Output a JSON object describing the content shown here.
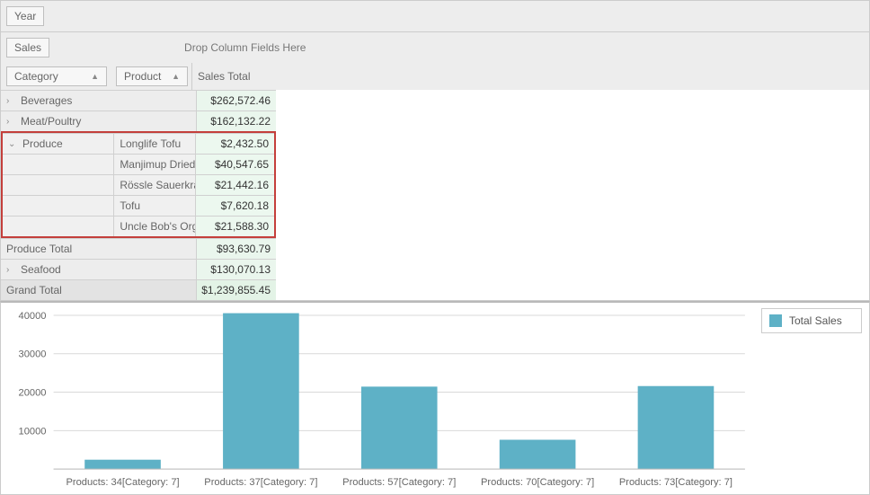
{
  "pivot": {
    "filter_field": "Year",
    "data_field": "Sales",
    "drop_hint": "Drop Column Fields Here",
    "row_fields": [
      {
        "label": "Category",
        "sort": "asc"
      },
      {
        "label": "Product",
        "sort": "asc"
      }
    ],
    "value_header": "Sales Total",
    "rows": [
      {
        "kind": "cat_collapsed",
        "label": "Beverages",
        "value": "$262,572.46"
      },
      {
        "kind": "cat_collapsed",
        "label": "Meat/Poultry",
        "value": "$162,132.22"
      }
    ],
    "produce": {
      "label": "Produce",
      "items": [
        {
          "label": "Longlife Tofu",
          "value": "$2,432.50"
        },
        {
          "label": "Manjimup Dried A...",
          "value": "$40,547.65"
        },
        {
          "label": "Rössle Sauerkraut",
          "value": "$21,442.16"
        },
        {
          "label": "Tofu",
          "value": "$7,620.18"
        },
        {
          "label": "Uncle Bob's Orga...",
          "value": "$21,588.30"
        }
      ]
    },
    "produce_total": {
      "label": "Produce Total",
      "value": "$93,630.79"
    },
    "after": [
      {
        "kind": "cat_collapsed",
        "label": "Seafood",
        "value": "$130,070.13"
      }
    ],
    "grand_total": {
      "label": "Grand Total",
      "value": "$1,239,855.45"
    }
  },
  "chart_data": {
    "type": "bar",
    "categories": [
      "Products: 34[Category: 7]",
      "Products: 37[Category: 7]",
      "Products: 57[Category: 7]",
      "Products: 70[Category: 7]",
      "Products: 73[Category: 7]"
    ],
    "values": [
      2433,
      40548,
      21442,
      7620,
      21588
    ],
    "ylim": [
      0,
      40000
    ],
    "yticks": [
      0,
      10000,
      20000,
      30000,
      40000
    ],
    "legend": "Total Sales"
  }
}
